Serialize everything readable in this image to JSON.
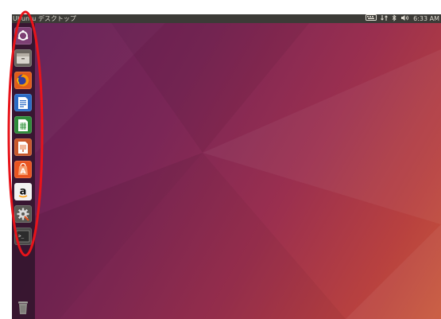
{
  "topbar": {
    "title": "Ubuntu デスクトップ",
    "clock": "6:33 AM"
  },
  "launcher": {
    "items": [
      {
        "icon": "ubuntu-dash-icon",
        "label": "Search your computer"
      },
      {
        "icon": "file-manager-icon",
        "label": "Files"
      },
      {
        "icon": "firefox-icon",
        "label": "Firefox Web Browser"
      },
      {
        "icon": "writer-icon",
        "label": "LibreOffice Writer"
      },
      {
        "icon": "calc-icon",
        "label": "LibreOffice Calc"
      },
      {
        "icon": "impress-icon",
        "label": "LibreOffice Impress"
      },
      {
        "icon": "software-center-icon",
        "label": "Ubuntu Software"
      },
      {
        "icon": "amazon-icon",
        "label": "Amazon"
      },
      {
        "icon": "system-settings-icon",
        "label": "System Settings"
      },
      {
        "icon": "terminal-icon",
        "label": "Terminal"
      },
      {
        "icon": "trash-icon",
        "label": "Trash"
      }
    ],
    "amazon_glyph": "a",
    "software_glyph": "A",
    "terminal_glyph": ">_"
  },
  "colors": {
    "highlight": "#e8131a",
    "topbar": "#3c3b37",
    "launcher": "#34162e"
  }
}
